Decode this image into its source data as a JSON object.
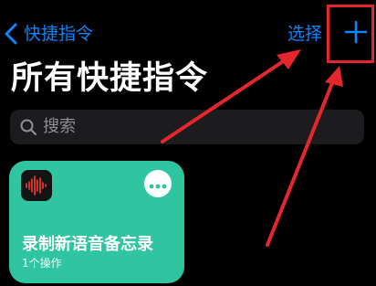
{
  "nav": {
    "back_label": "快捷指令",
    "back_icon": "chevron-left-icon",
    "select_label": "选择",
    "add_icon": "plus-icon"
  },
  "page": {
    "title": "所有快捷指令"
  },
  "search": {
    "placeholder": "搜索",
    "icon": "search-icon"
  },
  "shortcuts": [
    {
      "title": "录制新语音备忘录",
      "subtitle": "1个操作",
      "icon": "voice-memo-waveform-icon",
      "more_icon": "ellipsis-icon",
      "color": "#2fc5a0"
    }
  ],
  "colors": {
    "accent": "#0a84ff",
    "background": "#000000",
    "search_background": "#1c1c1e",
    "annotation_red": "#e5262d"
  }
}
